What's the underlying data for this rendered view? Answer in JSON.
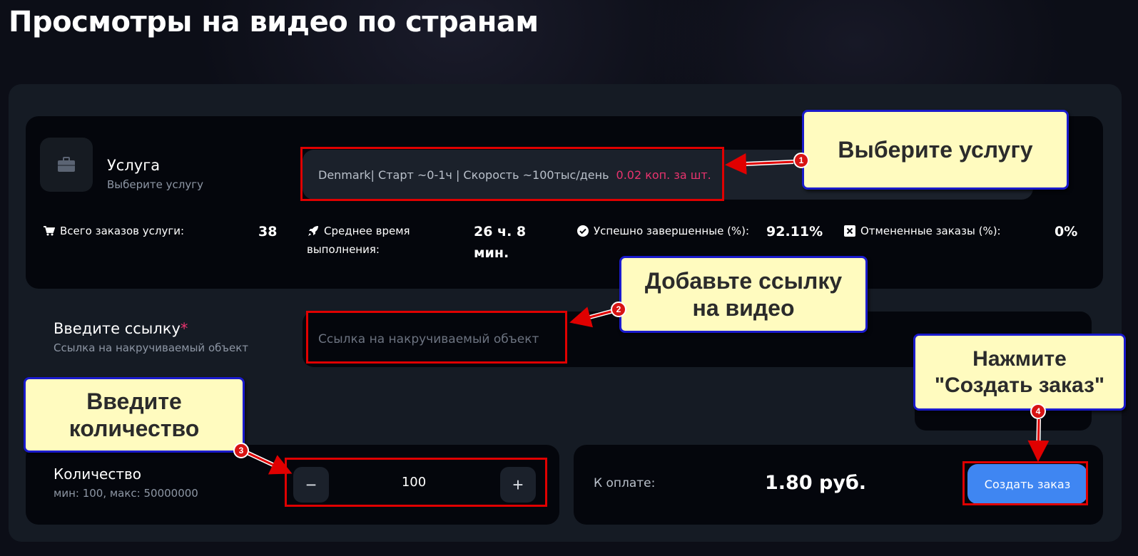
{
  "page": {
    "title": "Просмотры на видео по странам"
  },
  "service": {
    "label": "Услуга",
    "sublabel": "Выберите услугу",
    "selected_name": "Denmark| Старт ~0-1ч | Скорость ~100тыс/день",
    "selected_price": "0.02 коп. за шт.",
    "icon": "briefcase-icon"
  },
  "stats": {
    "total_orders": {
      "label": "Всего заказов услуги:",
      "value": "38",
      "icon": "cart-icon"
    },
    "avg_time": {
      "label_line1": "Среднее время",
      "label_line2": "выполнения:",
      "value_line1": "26 ч. 8",
      "value_line2": "мин.",
      "icon": "rocket-icon"
    },
    "success": {
      "label": "Успешно завершенные (%):",
      "value": "92.11%",
      "icon": "check-circle-icon"
    },
    "canceled": {
      "label": "Отмененные заказы (%):",
      "value": "0%",
      "icon": "x-square-icon"
    }
  },
  "link": {
    "label": "Введите ссылку",
    "required_mark": "*",
    "sublabel": "Ссылка на накручиваемый объект",
    "placeholder": "Ссылка на накручиваемый объект"
  },
  "quantity": {
    "label": "Количество",
    "sublabel": "мин: 100, макс: 50000000",
    "value": "100",
    "minus": "−",
    "plus": "+"
  },
  "payment": {
    "label": "К оплате:",
    "value": "1.80 руб.",
    "button": "Создать заказ"
  },
  "callouts": {
    "c1": {
      "text": "Выберите услугу",
      "number": "1"
    },
    "c2": {
      "line1": "Добавьте ссылку",
      "line2": "на видео",
      "number": "2"
    },
    "c3": {
      "line1": "Введите",
      "line2": "количество",
      "number": "3"
    },
    "c4": {
      "line1": "Нажмите",
      "line2": "\"Создать заказ\"",
      "number": "4"
    }
  },
  "colors": {
    "accent": "#3f86f2",
    "price": "#e8336e",
    "highlight": "#e00000",
    "callout_bg": "#fffbbf",
    "callout_border": "#1a1acc"
  }
}
